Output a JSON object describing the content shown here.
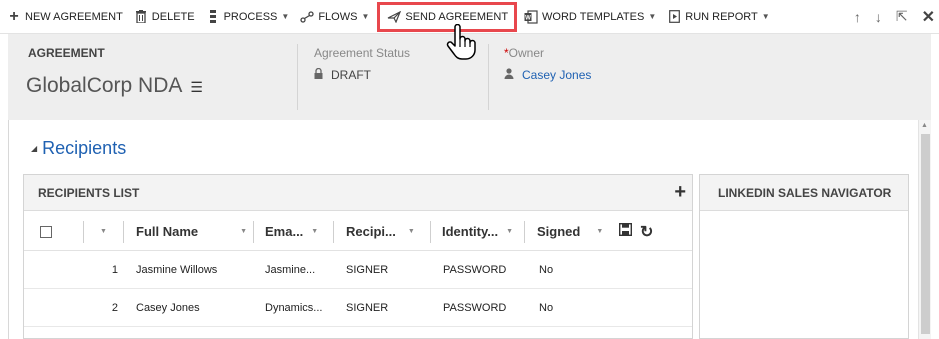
{
  "toolbar": {
    "new_agreement": "NEW AGREEMENT",
    "delete": "DELETE",
    "process": "PROCESS",
    "flows": "FLOWS",
    "send_agreement": "SEND AGREEMENT",
    "word_templates": "WORD TEMPLATES",
    "run_report": "RUN REPORT",
    "icons": {
      "new": "plus-icon",
      "delete": "trash-icon",
      "process": "process-icon",
      "flows": "flows-icon",
      "send": "send-icon",
      "word": "word-icon",
      "report": "report-icon",
      "up": "arrow-up-icon",
      "down": "arrow-down-icon",
      "popout": "popout-icon",
      "close": "close-icon"
    }
  },
  "header": {
    "entity_type": "AGREEMENT",
    "record_name": "GlobalCorp NDA",
    "status_label": "Agreement Status",
    "status_value": "DRAFT",
    "owner_label": "Owner",
    "owner_required_mark": "*",
    "owner_value": "Casey Jones"
  },
  "section": {
    "title": "Recipients"
  },
  "recipients": {
    "box_title": "RECIPIENTS LIST",
    "columns": [
      "Full Name",
      "Ema...",
      "Recipi...",
      "Identity...",
      "Signed"
    ],
    "rows": [
      {
        "num": "1",
        "full_name": "Jasmine Willows",
        "email": "Jasmine...",
        "recipient": "SIGNER",
        "identity": "PASSWORD",
        "signed": "No"
      },
      {
        "num": "2",
        "full_name": "Casey Jones",
        "email": "Dynamics...",
        "recipient": "SIGNER",
        "identity": "PASSWORD",
        "signed": "No"
      }
    ]
  },
  "linkedin": {
    "title": "LINKEDIN SALES NAVIGATOR"
  },
  "colors": {
    "link": "#1f61b2",
    "highlight_border": "#e8474d",
    "header_bg": "#eeeeee"
  }
}
